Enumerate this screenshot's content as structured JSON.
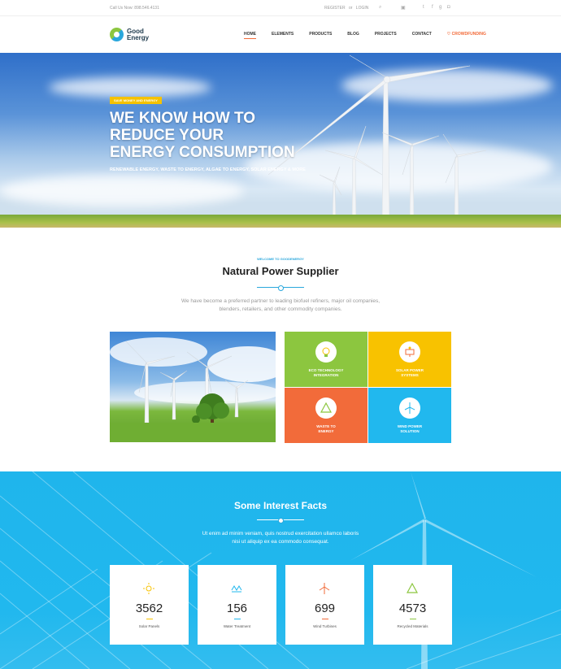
{
  "topbar": {
    "call": "Call Us Now: 898.546.4131",
    "register": "REGISTER",
    "or": "or",
    "login": "LOGIN",
    "icons": [
      "search-icon",
      "cart-icon",
      "twitter-icon",
      "facebook-icon",
      "google-plus-icon",
      "instagram-icon"
    ]
  },
  "logo": {
    "line1": "Good",
    "line2": "Energy"
  },
  "nav": {
    "items": [
      "HOME",
      "ELEMENTS",
      "PRODUCTS",
      "BLOG",
      "PROJECTS",
      "CONTACT"
    ],
    "crowdfunding": "CROWDFUNDING",
    "active": "HOME"
  },
  "hero": {
    "tag": "SAVE MONEY AND ENERGY",
    "title_line1": "WE KNOW HOW TO",
    "title_line2": "REDUCE YOUR",
    "title_line3": "ENERGY CONSUMPTION",
    "subtitle": "RENEWABLE ENERGY, WASTE TO ENERGY, ALGAE TO ENERGY, SOLAR ENERGY & MORE"
  },
  "welcome": {
    "tag": "WELCOME TO GOODENERGY",
    "title": "Natural Power Supplier",
    "desc": "We have become a preferred partner to leading biofuel refiners, major oil companies, blenders, retailers, and other commodity companies."
  },
  "services": [
    {
      "label1": "ECO TECHNOLOGY",
      "label2": "INTEGRATION",
      "color": "#8cc63f",
      "icon": "bulb-icon"
    },
    {
      "label1": "SOLAR POWER",
      "label2": "SYSTEMS",
      "color": "#f8c200",
      "icon": "solar-panel-icon"
    },
    {
      "label1": "WASTE TO",
      "label2": "ENERGY",
      "color": "#f26b3a",
      "icon": "recycle-icon"
    },
    {
      "label1": "WIND POWER",
      "label2": "SOLUTION",
      "color": "#21b8ee",
      "icon": "wind-turbine-icon"
    }
  ],
  "facts": {
    "title": "Some Interest Facts",
    "desc": "Ut enim ad minim veniam, quis nostrud exercitation ullamco laboris nisi ut aliquip ex ea commodo consequat.",
    "cards": [
      {
        "value": "3562",
        "label": "Solar Panels",
        "color": "#f8c200",
        "icon": "sun-icon"
      },
      {
        "value": "156",
        "label": "Water Treatment",
        "color": "#21b8ee",
        "icon": "water-icon"
      },
      {
        "value": "699",
        "label": "Wind Turbines",
        "color": "#f26b3a",
        "icon": "turbine-icon"
      },
      {
        "value": "4573",
        "label": "Recycled Materials",
        "color": "#8cc63f",
        "icon": "recycle-icon"
      }
    ]
  }
}
